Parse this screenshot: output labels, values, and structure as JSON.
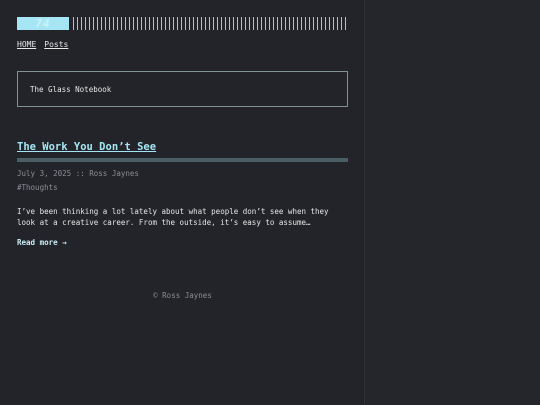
{
  "header": {
    "logo_text": "74"
  },
  "nav": {
    "items": [
      "HOME",
      "Posts"
    ]
  },
  "site": {
    "tagline": "The Glass Notebook"
  },
  "post": {
    "title": "The Work You Don’t See",
    "meta": "July 3, 2025 :: Ross Jaynes",
    "tag": "#Thoughts",
    "excerpt": "I’ve been thinking a lot lately about what people don’t see when they look at a creative career. From the outside, it’s easy to assume…",
    "read_more": "Read more →"
  },
  "footer": {
    "text": "© Ross Jaynes"
  },
  "colors": {
    "background": "#232429",
    "accent": "#a6e6f4",
    "muted": "#8a8d93"
  }
}
